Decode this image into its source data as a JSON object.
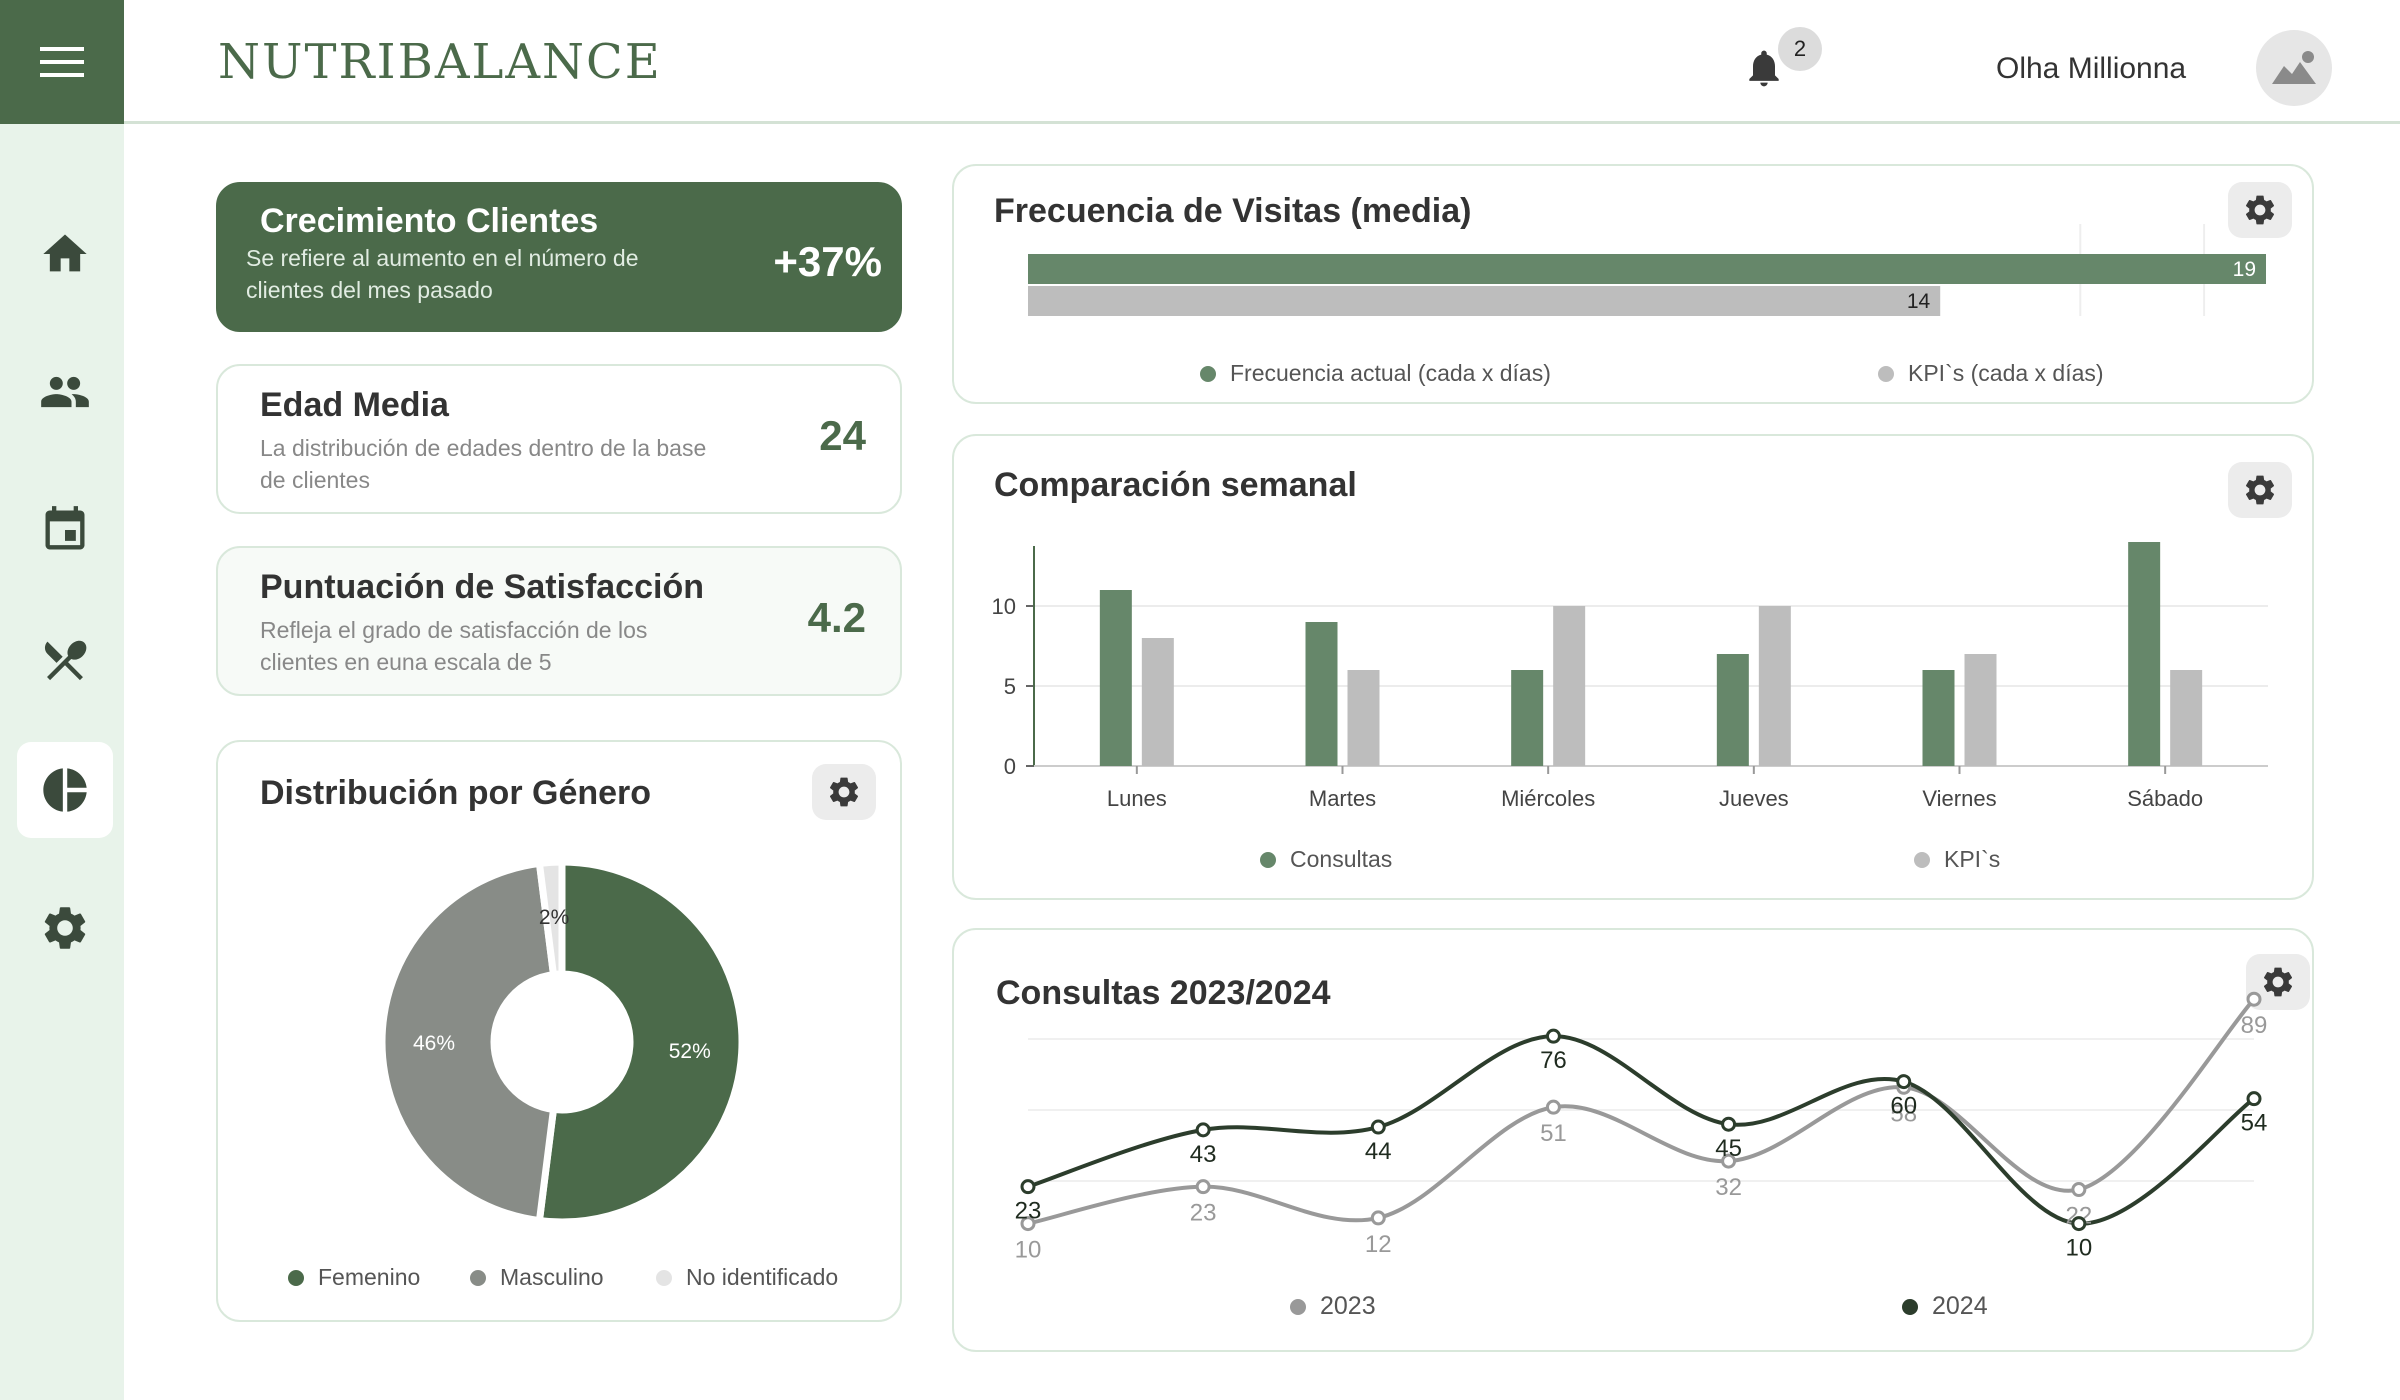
{
  "header": {
    "brand": "NUTRIBALANCE",
    "notifications_count": "2",
    "user_name": "Olha Millionna"
  },
  "sidebar": {
    "items": [
      {
        "icon": "home-icon"
      },
      {
        "icon": "users-icon"
      },
      {
        "icon": "calendar-icon"
      },
      {
        "icon": "utensils-icon"
      },
      {
        "icon": "pie-chart-icon",
        "active": true
      },
      {
        "icon": "gear-icon"
      }
    ]
  },
  "kpis": [
    {
      "title": "Crecimiento Clientes",
      "desc": "Se refiere al aumento en el número de clientes  del mes pasado",
      "value": "+37%"
    },
    {
      "title": "Edad Media",
      "desc": "La distribución de edades dentro de la base de clientes",
      "value": "24"
    },
    {
      "title": "Puntuación de Satisfacción",
      "desc": "Refleja el grado de satisfacción de los clientes en euna escala de 5",
      "value": "4.2"
    }
  ],
  "colors": {
    "primary": "#4b6a4a",
    "green_mid": "#66876a",
    "gray": "#bdbdbd",
    "gray_dark": "#888c87",
    "gray_light": "#e4e4e4",
    "line_2023": "#999999",
    "line_2024": "#2c3d2c"
  },
  "chart_data": [
    {
      "type": "pie",
      "title": "Distribución por Género",
      "labels": [
        "Femenino",
        "Masculino",
        "No identificado"
      ],
      "values": [
        52,
        46,
        2
      ],
      "value_labels": [
        "52%",
        "46%",
        "2%"
      ],
      "legend": "bottom"
    },
    {
      "type": "bar",
      "orientation": "horizontal",
      "title": "Frecuencia de Visitas (media)",
      "series": [
        {
          "name": "Frecuencia actual (cada x días)",
          "values": [
            19
          ]
        },
        {
          "name": "KPI`s (cada x días)",
          "values": [
            14
          ]
        }
      ],
      "xlim": [
        0,
        19
      ],
      "legend": "bottom"
    },
    {
      "type": "bar",
      "title": "Comparación semanal",
      "categories": [
        "Lunes",
        "Martes",
        "Miércoles",
        "Jueves",
        "Viernes",
        "Sábado"
      ],
      "series": [
        {
          "name": "Consultas",
          "values": [
            11,
            9,
            6,
            7,
            6,
            14
          ]
        },
        {
          "name": "KPI`s",
          "values": [
            8,
            6,
            10,
            10,
            7,
            6
          ]
        }
      ],
      "ylim": [
        0,
        14
      ],
      "yticks": [
        0,
        5,
        10
      ],
      "grid": true,
      "legend": "bottom"
    },
    {
      "type": "line",
      "title": "Consultas 2023/2024",
      "series": [
        {
          "name": "2023",
          "values": [
            10,
            23,
            12,
            51,
            32,
            58,
            22,
            89
          ]
        },
        {
          "name": "2024",
          "values": [
            23,
            43,
            44,
            76,
            45,
            60,
            10,
            54
          ]
        }
      ],
      "ylim": [
        0,
        100
      ],
      "grid": true,
      "legend": "bottom"
    }
  ]
}
